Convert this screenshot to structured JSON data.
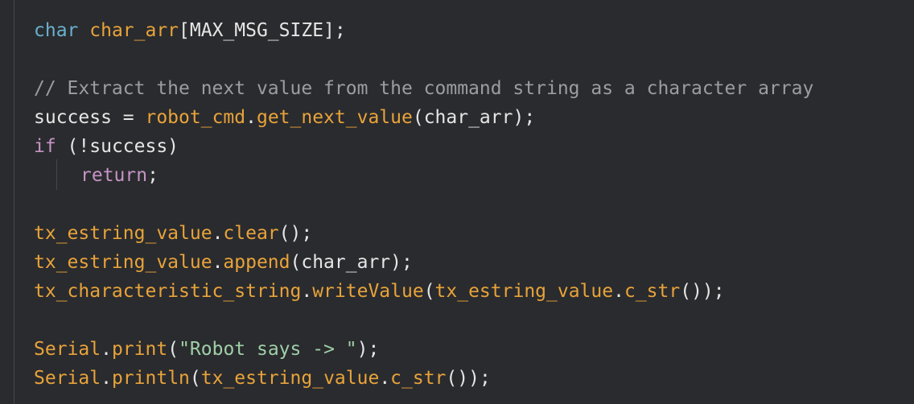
{
  "lines": [
    {
      "indent": 0,
      "tokens": [
        {
          "t": "char",
          "c": "ty"
        },
        {
          "t": " ",
          "c": "pl"
        },
        {
          "t": "char_arr",
          "c": "var"
        },
        {
          "t": "[MAX_MSG_SIZE];",
          "c": "pl"
        }
      ]
    },
    {
      "indent": 0,
      "tokens": []
    },
    {
      "indent": 0,
      "tokens": [
        {
          "t": "// Extract the next value from the command string as a character array",
          "c": "cm"
        }
      ]
    },
    {
      "indent": 0,
      "tokens": [
        {
          "t": "success = ",
          "c": "pl"
        },
        {
          "t": "robot_cmd",
          "c": "var"
        },
        {
          "t": ".",
          "c": "pl"
        },
        {
          "t": "get_next_value",
          "c": "fn"
        },
        {
          "t": "(char_arr);",
          "c": "pl"
        }
      ]
    },
    {
      "indent": 0,
      "tokens": [
        {
          "t": "if",
          "c": "kw"
        },
        {
          "t": " (!success)",
          "c": "pl"
        }
      ]
    },
    {
      "indent": 1,
      "tokens": [
        {
          "t": "return",
          "c": "kw"
        },
        {
          "t": ";",
          "c": "pl"
        }
      ]
    },
    {
      "indent": 0,
      "tokens": []
    },
    {
      "indent": 0,
      "tokens": [
        {
          "t": "tx_estring_value",
          "c": "var"
        },
        {
          "t": ".",
          "c": "pl"
        },
        {
          "t": "clear",
          "c": "fn"
        },
        {
          "t": "();",
          "c": "pl"
        }
      ]
    },
    {
      "indent": 0,
      "tokens": [
        {
          "t": "tx_estring_value",
          "c": "var"
        },
        {
          "t": ".",
          "c": "pl"
        },
        {
          "t": "append",
          "c": "fn"
        },
        {
          "t": "(char_arr);",
          "c": "pl"
        }
      ]
    },
    {
      "indent": 0,
      "tokens": [
        {
          "t": "tx_characteristic_string",
          "c": "var"
        },
        {
          "t": ".",
          "c": "pl"
        },
        {
          "t": "writeValue",
          "c": "fn"
        },
        {
          "t": "(",
          "c": "pl"
        },
        {
          "t": "tx_estring_value",
          "c": "var"
        },
        {
          "t": ".",
          "c": "pl"
        },
        {
          "t": "c_str",
          "c": "fn"
        },
        {
          "t": "());",
          "c": "pl"
        }
      ]
    },
    {
      "indent": 0,
      "tokens": []
    },
    {
      "indent": 0,
      "tokens": [
        {
          "t": "Serial",
          "c": "var"
        },
        {
          "t": ".",
          "c": "pl"
        },
        {
          "t": "print",
          "c": "fn"
        },
        {
          "t": "(",
          "c": "pl"
        },
        {
          "t": "\"Robot says -> \"",
          "c": "str"
        },
        {
          "t": ");",
          "c": "pl"
        }
      ]
    },
    {
      "indent": 0,
      "tokens": [
        {
          "t": "Serial",
          "c": "var"
        },
        {
          "t": ".",
          "c": "pl"
        },
        {
          "t": "println",
          "c": "fn"
        },
        {
          "t": "(",
          "c": "pl"
        },
        {
          "t": "tx_estring_value",
          "c": "var"
        },
        {
          "t": ".",
          "c": "pl"
        },
        {
          "t": "c_str",
          "c": "fn"
        },
        {
          "t": "());",
          "c": "pl"
        }
      ]
    }
  ],
  "colors": {
    "background": "#2a2b2e",
    "type": "#69b1cf",
    "keyword": "#c594c5",
    "identifier": "#e8a33a",
    "comment": "#9b9da1",
    "string": "#9fcfa8",
    "plain": "#e6e6e6"
  }
}
